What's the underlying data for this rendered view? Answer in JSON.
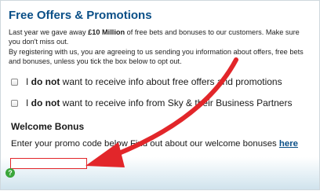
{
  "panel": {
    "title": "Free Offers & Promotions",
    "intro": {
      "before": "Last year we gave away ",
      "highlight": "£10 Million",
      "after": " of free bets and bonuses to our customers. Make sure you don't miss out."
    },
    "consent_text": "By registering with us, you are agreeing to us sending you information about offers, free bets and bonuses, unless you tick the box below to opt out."
  },
  "options": [
    {
      "prefix": "I ",
      "bold": "do not",
      "suffix": " want to receive info about free offers and promotions",
      "checked": false
    },
    {
      "prefix": "I ",
      "bold": "do not",
      "suffix": " want to receive info from Sky & their Business Partners",
      "checked": false
    }
  ],
  "welcome": {
    "heading": "Welcome Bonus",
    "prompt": "Enter your promo code below Find out about our welcome bonuses ",
    "link_label": "here",
    "promo_value": ""
  },
  "colors": {
    "title": "#0a4f87",
    "link": "#0a4f87",
    "annotation_arrow": "#e2262a",
    "input_border": "#e2262a",
    "help_icon": "#3aa63a"
  },
  "icons": {
    "help": "question-mark-icon",
    "annotation": "red-arrow-icon"
  },
  "help_glyph": "?"
}
